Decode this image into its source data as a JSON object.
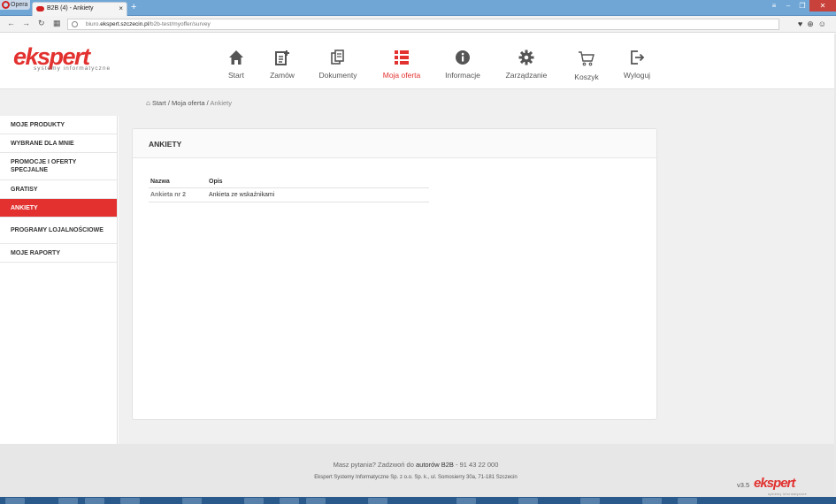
{
  "browser": {
    "opera_label": "Opera",
    "tab_title": "B2B (4) - Ankiety",
    "tab_close": "×",
    "new_tab": "+",
    "url_pre": "biuro.",
    "url_domain": "ekspert.szczecin.pl",
    "url_path": "/b2b-test/myoffer/survey"
  },
  "brand": {
    "logo_word": "ekspert",
    "logo_sub": "systemy informatyczne",
    "accent": "#e2312f"
  },
  "nav": {
    "items": [
      {
        "label": "Start",
        "icon": "home-icon"
      },
      {
        "label": "Zamów",
        "icon": "order-icon"
      },
      {
        "label": "Dokumenty",
        "icon": "documents-icon"
      },
      {
        "label": "Moja oferta",
        "icon": "list-icon"
      },
      {
        "label": "Informacje",
        "icon": "info-icon"
      },
      {
        "label": "Zarządzanie",
        "icon": "gear-icon"
      },
      {
        "label": "Koszyk",
        "icon": "cart-icon"
      },
      {
        "label": "Wyloguj",
        "icon": "logout-icon"
      }
    ]
  },
  "breadcrumb": {
    "start": "Start",
    "sep1": " / ",
    "offer": "Moja oferta",
    "sep2": " / ",
    "current": "Ankiety"
  },
  "sidebar": {
    "items": [
      {
        "label": "MOJE PRODUKTY"
      },
      {
        "label": "WYBRANE DLA MNIE"
      },
      {
        "label": "PROMOCJE I OFERTY SPECJALNE"
      },
      {
        "label": "GRATISY"
      },
      {
        "label": "ANKIETY"
      },
      {
        "label": "PROGRAMY LOJALNOŚCIOWE"
      },
      {
        "label": "MOJE RAPORTY"
      }
    ]
  },
  "panel": {
    "title": "ANKIETY",
    "columns": [
      "Nazwa",
      "Opis"
    ],
    "rows": [
      {
        "name": "Ankieta nr 2",
        "description": "Ankieta ze wskaźnikami"
      }
    ]
  },
  "footer": {
    "question_pre": "Masz pytania? Zadzwoń do ",
    "question_link": "autorów B2B",
    "question_post": " - 91 43 22 000",
    "address": "Ekspert Systemy Informatyczne Sp. z o.o. Sp. k., ul. Somosierry 30a, 71-181 Szczecin",
    "version": "v3.5",
    "logo_word": "ekspert",
    "logo_sub": "systemy informatyczne"
  }
}
